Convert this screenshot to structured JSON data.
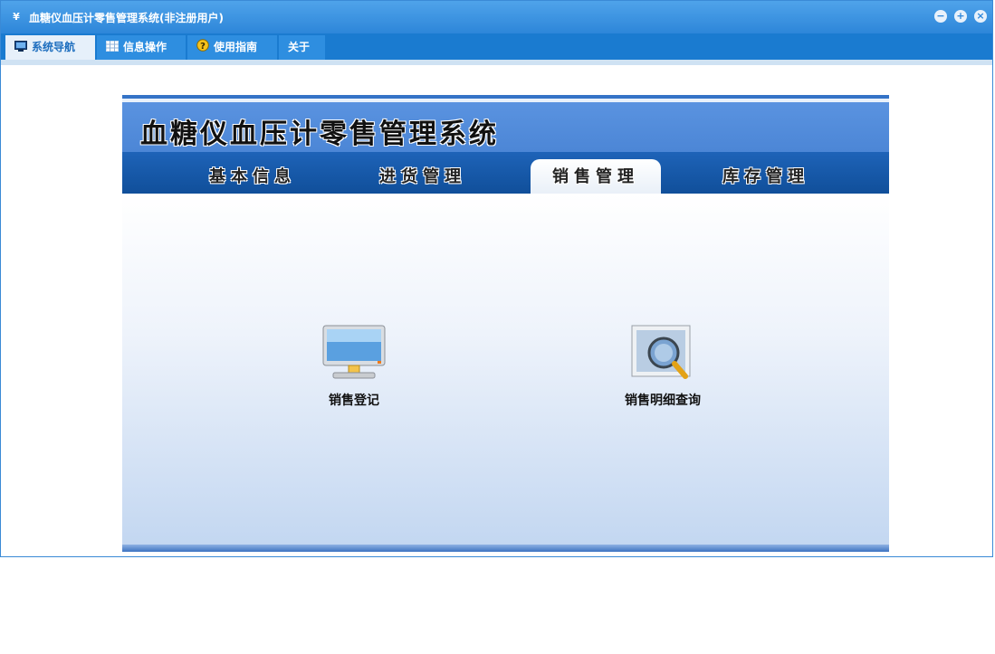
{
  "window": {
    "title": "血糖仪血压计零售管理系统(非注册用户)",
    "app_icon": "¥"
  },
  "window_controls": [
    {
      "name": "minimize",
      "glyph": "−"
    },
    {
      "name": "maximize",
      "glyph": "+"
    },
    {
      "name": "close",
      "glyph": "×"
    }
  ],
  "menubar": {
    "tabs": [
      {
        "label": "系统导航",
        "icon": "monitor-icon",
        "active": true
      },
      {
        "label": "信息操作",
        "icon": "grid-icon",
        "active": false
      },
      {
        "label": "使用指南",
        "icon": "help-icon",
        "active": false
      },
      {
        "label": "关于",
        "icon": "",
        "active": false
      }
    ]
  },
  "banner": {
    "title": "血糖仪血压计零售管理系统"
  },
  "nav": {
    "tabs": [
      {
        "label": "基本信息",
        "active": false
      },
      {
        "label": "进货管理",
        "active": false
      },
      {
        "label": "销售管理",
        "active": true
      },
      {
        "label": "库存管理",
        "active": false
      }
    ]
  },
  "features": [
    {
      "label": "销售登记",
      "icon": "computer-icon"
    },
    {
      "label": "销售明细查询",
      "icon": "magnifier-icon"
    }
  ],
  "colors": {
    "titlebar": "#2d86d9",
    "menubar": "#1a7bd0",
    "banner": "#4c86d6",
    "tabstrip": "#1e63b8"
  }
}
